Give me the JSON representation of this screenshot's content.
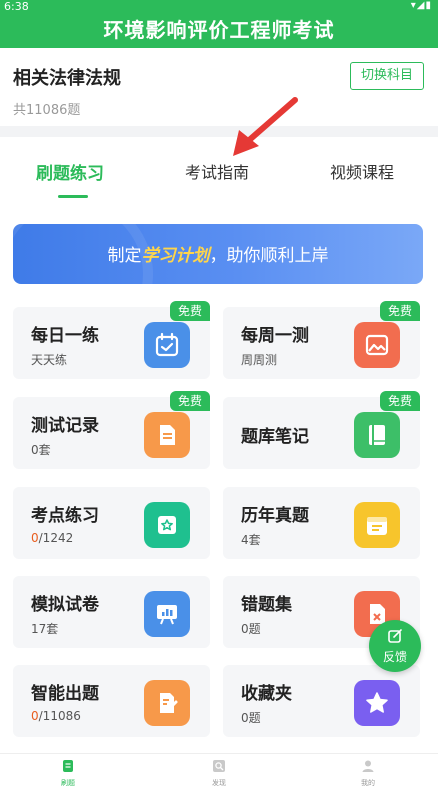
{
  "status_bar": {
    "time": "6:38",
    "icons": "▾◢▮"
  },
  "header": {
    "title": "环境影响评价工程师考试"
  },
  "subject": {
    "name": "相关法律法规",
    "count": "共11086题",
    "switch_label": "切换科目"
  },
  "tabs": [
    {
      "label": "刷题练习",
      "active": true
    },
    {
      "label": "考试指南",
      "active": false
    },
    {
      "label": "视频课程",
      "active": false
    }
  ],
  "banner": {
    "prefix": "制定",
    "highlight": "学习计划",
    "suffix": "，助你顺利上岸"
  },
  "cards": [
    {
      "title": "每日一练",
      "sub": "天天练",
      "badge": "免费",
      "icon": "calendar-check-icon",
      "color": "#4a90e8"
    },
    {
      "title": "每周一测",
      "sub": "周周测",
      "badge": "免费",
      "icon": "picture-icon",
      "color": "#f26d4f"
    },
    {
      "title": "测试记录",
      "sub": "0套",
      "badge": "免费",
      "icon": "document-icon",
      "color": "#f7994a"
    },
    {
      "title": "题库笔记",
      "sub": "",
      "badge": "免费",
      "icon": "notebook-icon",
      "color": "#3dbf68"
    },
    {
      "title": "考点练习",
      "sub_zero": "0",
      "sub_rest": "/1242",
      "icon": "star-card-icon",
      "color": "#1fc08f"
    },
    {
      "title": "历年真题",
      "sub": "4套",
      "icon": "calendar-icon",
      "color": "#f7c52c"
    },
    {
      "title": "模拟试卷",
      "sub": "17套",
      "icon": "presentation-icon",
      "color": "#4a90e8"
    },
    {
      "title": "错题集",
      "sub": "0题",
      "icon": "wrong-doc-icon",
      "color": "#f26d4f"
    },
    {
      "title": "智能出题",
      "sub_zero": "0",
      "sub_rest": "/11086",
      "icon": "edit-doc-icon",
      "color": "#f7994a"
    },
    {
      "title": "收藏夹",
      "sub": "0题",
      "icon": "star-icon",
      "color": "#7a5ff0"
    }
  ],
  "feedback": {
    "label": "反馈"
  },
  "bottom_nav": [
    {
      "label": "刷题",
      "icon": "practice-icon",
      "active": true
    },
    {
      "label": "发现",
      "icon": "discover-icon",
      "active": false
    },
    {
      "label": "我的",
      "icon": "profile-icon",
      "active": false
    }
  ],
  "colors": {
    "brand": "#2cbb5a",
    "accent_orange": "#e85d1f",
    "highlight_yellow": "#ffd54a"
  }
}
